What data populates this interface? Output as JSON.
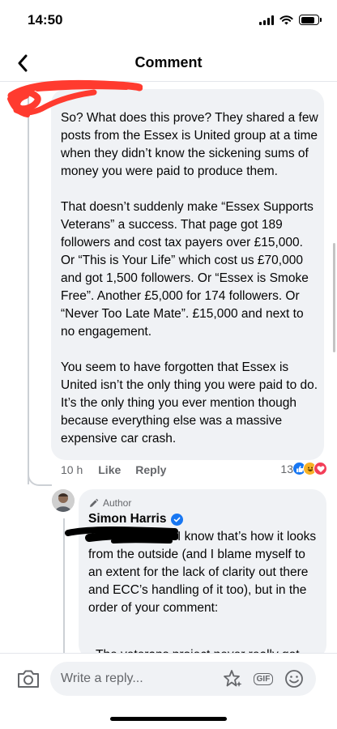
{
  "status_bar": {
    "time": "14:50"
  },
  "nav": {
    "title": "Comment"
  },
  "comment": {
    "body": "So? What does this prove? They shared a few posts from the Essex is United group at a time when they didn’t know the sickening sums of money you were paid to produce them.\n\nThat doesn’t suddenly make “Essex Supports Veterans” a success. That page got 189 followers and cost tax payers over £15,000. Or “This is Your Life” which cost us £70,000 and got 1,500 followers. Or “Essex is Smoke Free”. Another £5,000 for 174 followers. Or “Never Too Late Mate”. £15,000 and next to no engagement.\n\nYou seem to have forgotten that Essex is United isn’t the only thing you were paid to do. It’s the only thing you ever mention though because everything else was a massive expensive car crash.",
    "time": "10 h",
    "like_label": "Like",
    "reply_label": "Reply",
    "reaction_count": "13",
    "reactions": [
      "like-icon",
      "haha-icon",
      "love-icon"
    ]
  },
  "reply": {
    "author_badge": "Author",
    "author_name": "Simon Harris",
    "body": "I know that’s how it looks from the outside (and I blame myself to an extent for the lack of clarity out there and ECC’s handling of it too), but in the order of your comment:",
    "cut_line": "The veterans project never really got"
  },
  "composer": {
    "placeholder": "Write a reply...",
    "gif_label": "GIF"
  },
  "colors": {
    "accent": "#1877f2",
    "bubble": "#f0f2f5",
    "secondary_text": "#65676b",
    "redaction_red": "#ff3b2f",
    "redaction_black": "#000000"
  }
}
